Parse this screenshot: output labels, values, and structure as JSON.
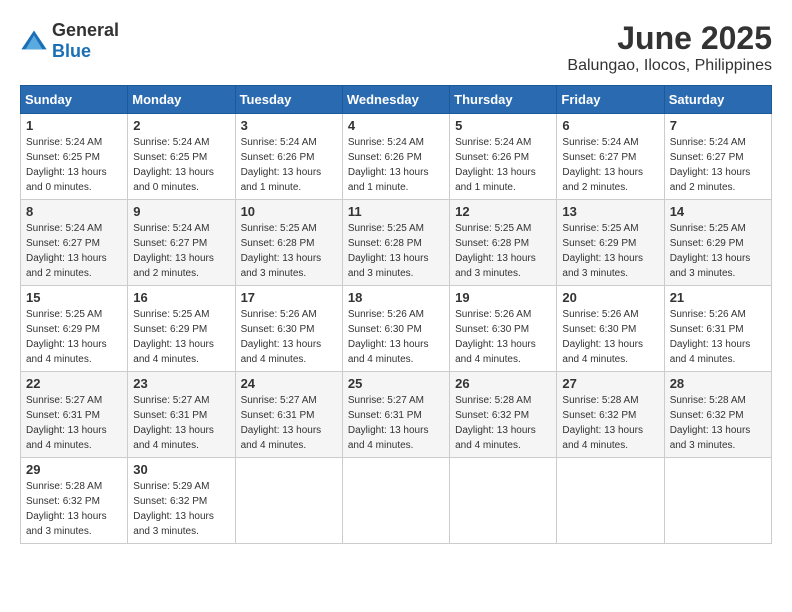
{
  "logo": {
    "general": "General",
    "blue": "Blue"
  },
  "title": {
    "month": "June 2025",
    "location": "Balungao, Ilocos, Philippines"
  },
  "weekdays": [
    "Sunday",
    "Monday",
    "Tuesday",
    "Wednesday",
    "Thursday",
    "Friday",
    "Saturday"
  ],
  "weeks": [
    [
      {
        "day": 1,
        "sunrise": "5:24 AM",
        "sunset": "6:25 PM",
        "daylight": "13 hours and 0 minutes."
      },
      {
        "day": 2,
        "sunrise": "5:24 AM",
        "sunset": "6:25 PM",
        "daylight": "13 hours and 0 minutes."
      },
      {
        "day": 3,
        "sunrise": "5:24 AM",
        "sunset": "6:26 PM",
        "daylight": "13 hours and 1 minute."
      },
      {
        "day": 4,
        "sunrise": "5:24 AM",
        "sunset": "6:26 PM",
        "daylight": "13 hours and 1 minute."
      },
      {
        "day": 5,
        "sunrise": "5:24 AM",
        "sunset": "6:26 PM",
        "daylight": "13 hours and 1 minute."
      },
      {
        "day": 6,
        "sunrise": "5:24 AM",
        "sunset": "6:27 PM",
        "daylight": "13 hours and 2 minutes."
      },
      {
        "day": 7,
        "sunrise": "5:24 AM",
        "sunset": "6:27 PM",
        "daylight": "13 hours and 2 minutes."
      }
    ],
    [
      {
        "day": 8,
        "sunrise": "5:24 AM",
        "sunset": "6:27 PM",
        "daylight": "13 hours and 2 minutes."
      },
      {
        "day": 9,
        "sunrise": "5:24 AM",
        "sunset": "6:27 PM",
        "daylight": "13 hours and 2 minutes."
      },
      {
        "day": 10,
        "sunrise": "5:25 AM",
        "sunset": "6:28 PM",
        "daylight": "13 hours and 3 minutes."
      },
      {
        "day": 11,
        "sunrise": "5:25 AM",
        "sunset": "6:28 PM",
        "daylight": "13 hours and 3 minutes."
      },
      {
        "day": 12,
        "sunrise": "5:25 AM",
        "sunset": "6:28 PM",
        "daylight": "13 hours and 3 minutes."
      },
      {
        "day": 13,
        "sunrise": "5:25 AM",
        "sunset": "6:29 PM",
        "daylight": "13 hours and 3 minutes."
      },
      {
        "day": 14,
        "sunrise": "5:25 AM",
        "sunset": "6:29 PM",
        "daylight": "13 hours and 3 minutes."
      }
    ],
    [
      {
        "day": 15,
        "sunrise": "5:25 AM",
        "sunset": "6:29 PM",
        "daylight": "13 hours and 4 minutes."
      },
      {
        "day": 16,
        "sunrise": "5:25 AM",
        "sunset": "6:29 PM",
        "daylight": "13 hours and 4 minutes."
      },
      {
        "day": 17,
        "sunrise": "5:26 AM",
        "sunset": "6:30 PM",
        "daylight": "13 hours and 4 minutes."
      },
      {
        "day": 18,
        "sunrise": "5:26 AM",
        "sunset": "6:30 PM",
        "daylight": "13 hours and 4 minutes."
      },
      {
        "day": 19,
        "sunrise": "5:26 AM",
        "sunset": "6:30 PM",
        "daylight": "13 hours and 4 minutes."
      },
      {
        "day": 20,
        "sunrise": "5:26 AM",
        "sunset": "6:30 PM",
        "daylight": "13 hours and 4 minutes."
      },
      {
        "day": 21,
        "sunrise": "5:26 AM",
        "sunset": "6:31 PM",
        "daylight": "13 hours and 4 minutes."
      }
    ],
    [
      {
        "day": 22,
        "sunrise": "5:27 AM",
        "sunset": "6:31 PM",
        "daylight": "13 hours and 4 minutes."
      },
      {
        "day": 23,
        "sunrise": "5:27 AM",
        "sunset": "6:31 PM",
        "daylight": "13 hours and 4 minutes."
      },
      {
        "day": 24,
        "sunrise": "5:27 AM",
        "sunset": "6:31 PM",
        "daylight": "13 hours and 4 minutes."
      },
      {
        "day": 25,
        "sunrise": "5:27 AM",
        "sunset": "6:31 PM",
        "daylight": "13 hours and 4 minutes."
      },
      {
        "day": 26,
        "sunrise": "5:28 AM",
        "sunset": "6:32 PM",
        "daylight": "13 hours and 4 minutes."
      },
      {
        "day": 27,
        "sunrise": "5:28 AM",
        "sunset": "6:32 PM",
        "daylight": "13 hours and 4 minutes."
      },
      {
        "day": 28,
        "sunrise": "5:28 AM",
        "sunset": "6:32 PM",
        "daylight": "13 hours and 3 minutes."
      }
    ],
    [
      {
        "day": 29,
        "sunrise": "5:28 AM",
        "sunset": "6:32 PM",
        "daylight": "13 hours and 3 minutes."
      },
      {
        "day": 30,
        "sunrise": "5:29 AM",
        "sunset": "6:32 PM",
        "daylight": "13 hours and 3 minutes."
      },
      null,
      null,
      null,
      null,
      null
    ]
  ]
}
